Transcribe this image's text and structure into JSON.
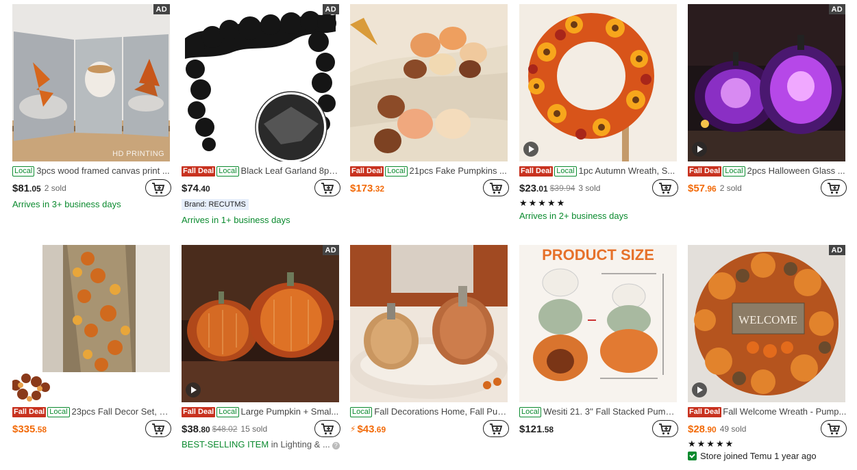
{
  "products": [
    {
      "title": "3pcs wood framed canvas print ...",
      "fall_deal": "",
      "local": "Local",
      "ad": "AD",
      "watermark": "HD PRINTING",
      "price_main": "$81",
      "price_cents": ".05",
      "price_color": "dark",
      "original_price": "",
      "sold": "2 sold",
      "lightning": false,
      "extra": {
        "delivery": "Arrives in 3+ business days"
      }
    },
    {
      "title": "Black Leaf Garland 8pc...",
      "fall_deal": "Fall Deal",
      "local": "Local",
      "ad": "AD",
      "price_main": "$74",
      "price_cents": ".40",
      "price_color": "dark",
      "original_price": "",
      "sold": "",
      "extra": {
        "brand": "Brand: RECUTMS",
        "delivery": "Arrives in 1+ business days"
      }
    },
    {
      "title": "21pcs Fake Pumpkins ...",
      "fall_deal": "Fall Deal",
      "local": "Local",
      "ad": "",
      "price_main": "$173",
      "price_cents": ".32",
      "price_color": "orange",
      "original_price": "",
      "sold": "",
      "extra": {}
    },
    {
      "title": "1pc Autumn Wreath, S...",
      "fall_deal": "Fall Deal",
      "local": "Local",
      "ad": "",
      "video": true,
      "price_main": "$23",
      "price_cents": ".01",
      "price_color": "dark",
      "original_price": "$39.94",
      "sold": "3 sold",
      "extra": {
        "stars": "★★★★★",
        "delivery": "Arrives in 2+ business days"
      }
    },
    {
      "title": "2pcs Halloween Glass ...",
      "fall_deal": "Fall Deal",
      "local": "Local",
      "ad": "AD",
      "video": true,
      "price_main": "$57",
      "price_cents": ".96",
      "price_color": "orange",
      "original_price": "",
      "sold": "2 sold",
      "extra": {}
    },
    {
      "title": "23pcs Fall Decor Set, 6...",
      "fall_deal": "Fall Deal",
      "local": "Local",
      "ad": "",
      "price_main": "$335",
      "price_cents": ".58",
      "price_color": "orange",
      "original_price": "",
      "sold": "",
      "extra": {}
    },
    {
      "title": "Large Pumpkin + Smal...",
      "fall_deal": "Fall Deal",
      "local": "Local",
      "ad": "AD",
      "video": true,
      "price_main": "$38",
      "price_cents": ".80",
      "price_color": "dark",
      "original_price": "$48.02",
      "sold": "15 sold",
      "extra": {
        "best_selling": "BEST-SELLING ITEM",
        "best_category": "in Lighting & ..."
      }
    },
    {
      "title": "Fall Decorations Home, Fall Pum...",
      "fall_deal": "",
      "local": "Local",
      "ad": "",
      "price_main": "$43",
      "price_cents": ".69",
      "price_color": "orange",
      "lightning": true,
      "original_price": "",
      "sold": "",
      "extra": {}
    },
    {
      "title": "Wesiti 21. 3'' Fall Stacked Pumpk...",
      "fall_deal": "",
      "local": "Local",
      "ad": "",
      "image_caption": "PRODUCT SIZE",
      "price_main": "$121",
      "price_cents": ".58",
      "price_color": "dark",
      "original_price": "",
      "sold": "",
      "extra": {}
    },
    {
      "title": "Fall Welcome Wreath - Pump...",
      "fall_deal": "Fall Deal",
      "local": "",
      "ad": "AD",
      "video": true,
      "image_caption": "WELCOME",
      "price_main": "$28",
      "price_cents": ".90",
      "price_color": "orange",
      "original_price": "",
      "sold": "49 sold",
      "extra": {
        "stars": "★★★★★",
        "store": "Store joined Temu 1 year ago"
      }
    }
  ]
}
